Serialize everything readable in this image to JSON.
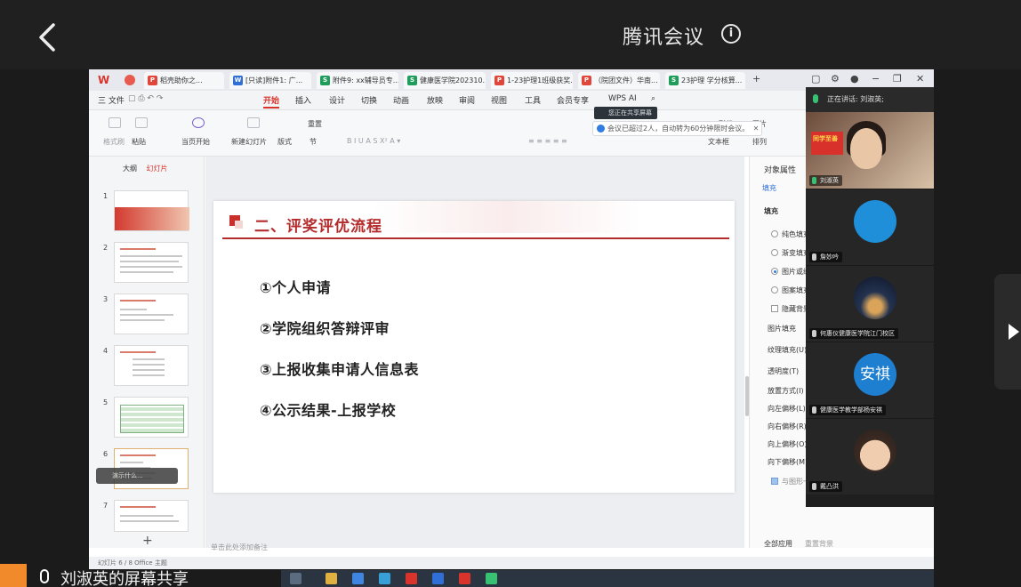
{
  "meeting": {
    "title": "腾讯会议",
    "info_icon_glyph": "i",
    "sharer_text": "刘淑英的屏幕共享"
  },
  "wps": {
    "tabs": [
      {
        "label": "稻壳助你之...",
        "color": "#e0463a",
        "glyph": "P"
      },
      {
        "label": "[只读]附件1: 广...",
        "color": "#2f6fd6",
        "glyph": "W"
      },
      {
        "label": "附件9: xx辅导员专...",
        "color": "#1e9e5a",
        "glyph": "S"
      },
      {
        "label": "健康医学院202310...",
        "color": "#1e9e5a",
        "glyph": "S"
      },
      {
        "label": "1-23护理1班级获奖...",
        "color": "#e0463a",
        "glyph": "P"
      },
      {
        "label": "（院团文件）华南...",
        "color": "#e0463a",
        "glyph": "P"
      },
      {
        "label": "23护理 学分核算...",
        "color": "#1e9e5a",
        "glyph": "S"
      }
    ],
    "menu": [
      "三 文件",
      "开始",
      "插入",
      "设计",
      "切换",
      "动画",
      "放映",
      "审阅",
      "视图",
      "工具",
      "会员专享",
      "WPS AI"
    ],
    "ribbon": {
      "format_painter": "格式刷",
      "paste": "粘贴",
      "start_current": "当页开始",
      "new_slide": "新建幻灯片",
      "layout": "版式",
      "section": "节",
      "reset": "重置",
      "shape": "形状",
      "picture": "图片",
      "textbox": "文本框",
      "arrange": "排列"
    },
    "notice": "会议已超过2人，自动转为60分钟限时会议。",
    "sharing_chip": "您正在共享屏幕",
    "left_panel": {
      "tab_outline": "大纲",
      "tab_slides": "幻灯片",
      "slide_numbers": [
        "1",
        "2",
        "3",
        "4",
        "5",
        "6",
        "7"
      ],
      "video_tip": "演示什么..."
    },
    "slide": {
      "title": "二、评奖评优流程",
      "items": [
        "①个人申请",
        "②学院组织答辩评审",
        "③上报收集申请人信息表",
        "④公示结果-上报学校"
      ]
    },
    "notes_placeholder": "单击此处添加备注",
    "right_panel": {
      "header": "对象属性",
      "fill_tab": "填充",
      "fill_section": "填充",
      "options": [
        "纯色填充",
        "渐变填充",
        "图片或纹理填充",
        "图案填充",
        "隐藏背景图形"
      ],
      "labels": [
        "图片填充",
        "纹理填充(U)",
        "透明度(T)",
        "放置方式(I)",
        "向左偏移(L)",
        "向右偏移(R)",
        "向上偏移(O)",
        "向下偏移(M)",
        "与图形一起旋转"
      ],
      "apply_all": "全部应用",
      "reset_bg": "重置背景"
    },
    "status": "幻灯片 6 / 8   Office 主题"
  },
  "participants": {
    "speaking": "正在讲话: 刘淑英;",
    "list": [
      {
        "name": "刘淑英",
        "kind": "camera"
      },
      {
        "name": "詹妙吟",
        "kind": "avatar"
      },
      {
        "name": "何惠仪健康医学院江门校区",
        "kind": "photo"
      },
      {
        "name": "健康医学教学部杨安祺",
        "kind": "text",
        "avatar_text": "安祺"
      },
      {
        "name": "戴凸洪",
        "kind": "photo2"
      }
    ],
    "camera_banner": "同学至善"
  },
  "colors": {
    "accent_red": "#b42c2c",
    "wps_red": "#d9342b",
    "avatar_blue": "#1e8fd8",
    "mic_green": "#38c172"
  }
}
